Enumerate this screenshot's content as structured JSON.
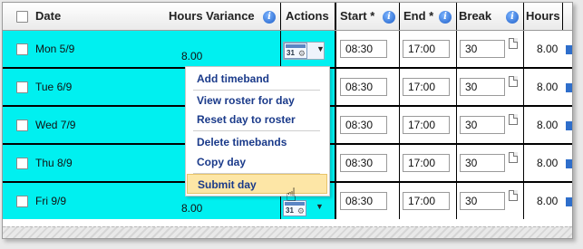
{
  "table": {
    "headers": {
      "date": "Date",
      "hours_variance": "Hours Variance",
      "actions": "Actions",
      "start": "Start *",
      "end": "End *",
      "break": "Break",
      "hours": "Hours"
    },
    "rows": [
      {
        "date": "Mon 5/9",
        "hours_variance": "8.00",
        "start": "08:30",
        "end": "17:00",
        "break": "30",
        "hours": "8.00"
      },
      {
        "date": "Tue 6/9",
        "hours_variance": "",
        "start": "08:30",
        "end": "17:00",
        "break": "30",
        "hours": "8.00"
      },
      {
        "date": "Wed 7/9",
        "hours_variance": "",
        "start": "08:30",
        "end": "17:00",
        "break": "30",
        "hours": "8.00"
      },
      {
        "date": "Thu 8/9",
        "hours_variance": "",
        "start": "08:30",
        "end": "17:00",
        "break": "30",
        "hours": "8.00"
      },
      {
        "date": "Fri 9/9",
        "hours_variance": "8.00",
        "start": "08:30",
        "end": "17:00",
        "break": "30",
        "hours": "8.00"
      }
    ],
    "action_icon_number": "31"
  },
  "actions_menu": {
    "items": [
      "Add timeband",
      "View roster for day",
      "Reset day to roster",
      "Delete timebands",
      "Copy day",
      "Submit day"
    ],
    "highlighted": "Submit day"
  },
  "icons": {
    "info": "info-icon",
    "calendar": "calendar-gear-icon",
    "dropdown": "chevron-down-icon",
    "break_note": "document-icon",
    "cursor": "hand-pointer-icon"
  },
  "colors": {
    "row_highlight": "#00f0f0",
    "menu_text": "#1a3a8a",
    "menu_highlight": "#fde6a6",
    "info_icon": "#1f5fc8"
  }
}
